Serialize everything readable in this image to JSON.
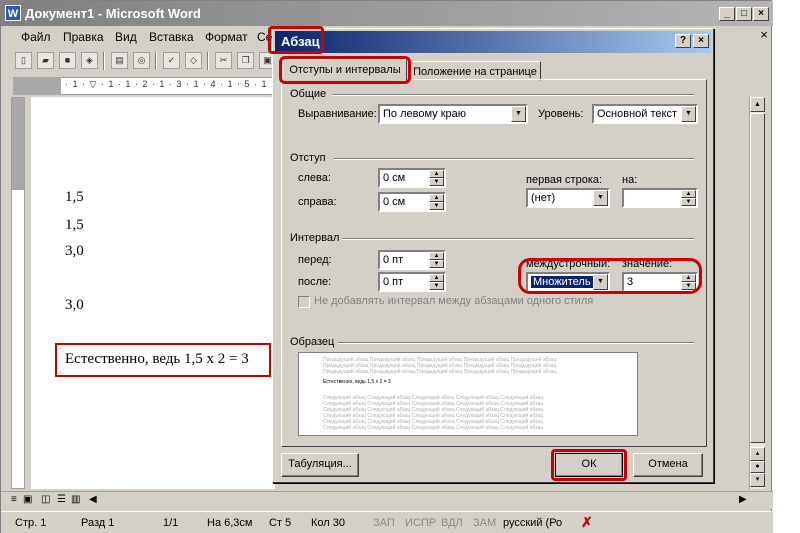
{
  "word": {
    "title": "Документ1 - Microsoft Word",
    "icon": "W",
    "menu": [
      "Файл",
      "Правка",
      "Вид",
      "Вставка",
      "Формат",
      "Се"
    ],
    "ruler_text": "· 1 · ▽ · 1 · 1 · 2 · 1 · 3 · 1 · 4 · 1 · 5 · 1 · 6",
    "document": {
      "lines": [
        "1,5",
        "1,5",
        "3,0",
        "3,0"
      ],
      "highlight": "Естественно, ведь 1,5 х 2 = 3"
    },
    "statusbar": {
      "page": "Стр.  1",
      "section": "Разд  1",
      "pages": "1/1",
      "at": "На 6,3см",
      "line": "Ст  5",
      "col": "Кол  30",
      "rec": "ЗАП",
      "trk": "ИСПР",
      "ext": "ВДЛ",
      "ovr": "ЗАМ",
      "lang": "русский (Ро"
    }
  },
  "dialog": {
    "title": "Абзац",
    "tabs": [
      "Отступы и интервалы",
      "Положение на странице"
    ],
    "general": {
      "heading": "Общие",
      "alignment_label": "Выравнивание:",
      "alignment_value": "По левому краю",
      "level_label": "Уровень:",
      "level_value": "Основной текст"
    },
    "indent": {
      "heading": "Отступ",
      "left_label": "слева:",
      "left_value": "0 см",
      "right_label": "справа:",
      "right_value": "0 см",
      "first_line_label": "первая строка:",
      "first_line_value": "(нет)",
      "by_label": "на:",
      "by_value": ""
    },
    "spacing": {
      "heading": "Интервал",
      "before_label": "перед:",
      "before_value": "0 пт",
      "after_label": "после:",
      "after_value": "0 пт",
      "line_label": "междустрочный:",
      "line_value": "Множитель",
      "at_label": "значение:",
      "at_value": "3",
      "checkbox_label": "Не добавлять интервал между абзацами одного стиля"
    },
    "preview": {
      "heading": "Образец",
      "gray_line": "Предыдущий абзац Предыдущий абзац Предыдущий абзац Предыдущий абзац Предыдущий абзац",
      "sample_line": "Естественно, ведь 1,5 х 2 = 3",
      "next_line": "Следующий абзац Следующий абзац Следующий абзац Следующий абзац Следующий абзац"
    },
    "buttons": {
      "tabs": "Табуляция...",
      "ok": "ОК",
      "cancel": "Отмена"
    },
    "highlight_color": "#cc0000"
  }
}
